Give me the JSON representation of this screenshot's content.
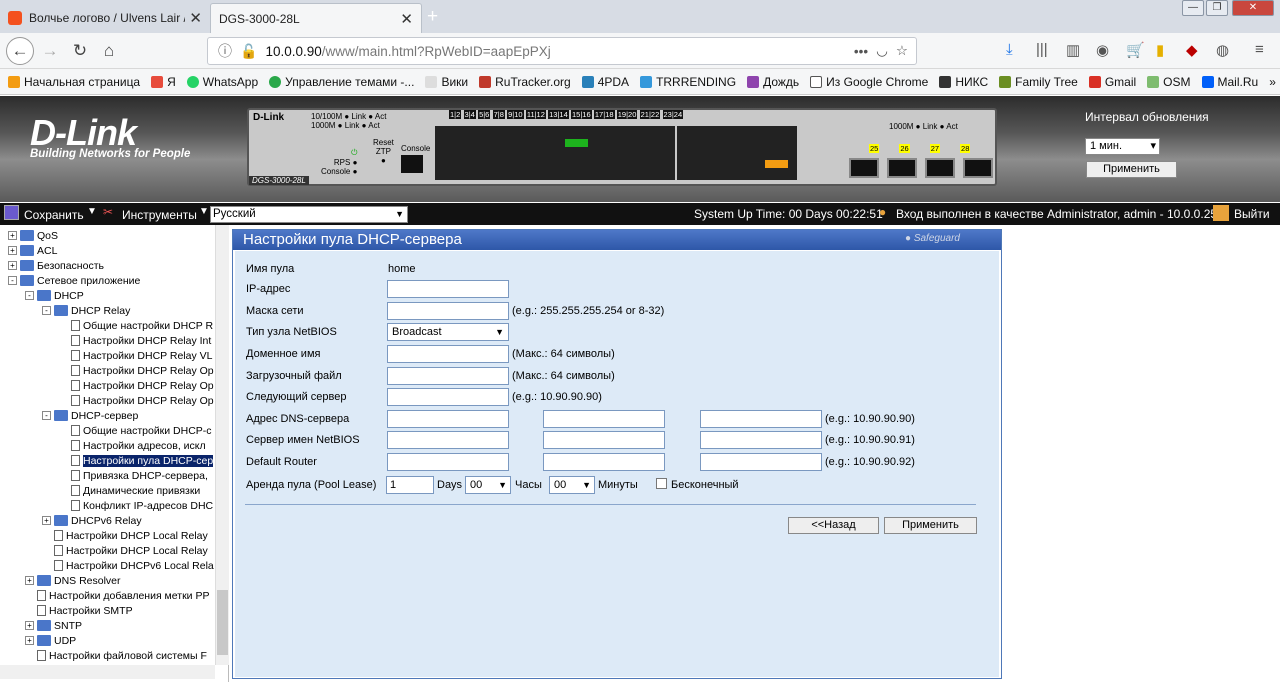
{
  "browser": {
    "tabs": [
      {
        "title": "Волчье логово / Ulvens Lair /"
      },
      {
        "title": "DGS-3000-28L"
      }
    ],
    "url_host": "10.0.0.90",
    "url_path": "/www/main.html?RpWebID=aapEpPXj",
    "bookmarks": [
      "Начальная страница",
      "Я",
      "WhatsApp",
      "Управление темами -...",
      "Вики",
      "RuTracker.org",
      "4PDA",
      "TRRRENDING",
      "Дождь",
      "Из Google Chrome",
      "НИКС",
      "Family Tree",
      "Gmail",
      "OSM",
      "Mail.Ru"
    ]
  },
  "banner": {
    "logo": "D-Link",
    "slogan": "Building Networks for People",
    "model": "DGS-3000-28L",
    "interval_label": "Интервал обновления",
    "interval_value": "1 мин.",
    "apply_label": "Применить"
  },
  "toolbar": {
    "save": "Сохранить",
    "tools": "Инструменты",
    "language": "Русский",
    "status": "System Up Time: 00 Days 00:22:51",
    "login": "Вход выполнен в качестве  Administrator, admin - 10.0.0.25",
    "logout": "Выйти"
  },
  "tree": [
    {
      "label": "QoS",
      "level": 0,
      "type": "folder",
      "exp": "+"
    },
    {
      "label": "ACL",
      "level": 0,
      "type": "folder",
      "exp": "+"
    },
    {
      "label": "Безопасность",
      "level": 0,
      "type": "folder",
      "exp": "+"
    },
    {
      "label": "Сетевое приложение",
      "level": 0,
      "type": "folder",
      "exp": "-"
    },
    {
      "label": "DHCP",
      "level": 1,
      "type": "folder",
      "exp": "-"
    },
    {
      "label": "DHCP Relay",
      "level": 2,
      "type": "folder",
      "exp": "-"
    },
    {
      "label": "Общие настройки DHCP R",
      "level": 3,
      "type": "doc"
    },
    {
      "label": "Настройки DHCP Relay Int",
      "level": 3,
      "type": "doc"
    },
    {
      "label": "Настройки DHCP Relay VL",
      "level": 3,
      "type": "doc"
    },
    {
      "label": "Настройки DHCP Relay Op",
      "level": 3,
      "type": "doc"
    },
    {
      "label": "Настройки DHCP Relay Op",
      "level": 3,
      "type": "doc"
    },
    {
      "label": "Настройки DHCP Relay Op",
      "level": 3,
      "type": "doc"
    },
    {
      "label": "DHCP-сервер",
      "level": 2,
      "type": "folder",
      "exp": "-"
    },
    {
      "label": "Общие настройки DHCP-с",
      "level": 3,
      "type": "doc"
    },
    {
      "label": "Настройки адресов, искл",
      "level": 3,
      "type": "doc"
    },
    {
      "label": "Настройки пула DHCP-сер",
      "level": 3,
      "type": "doc",
      "selected": true
    },
    {
      "label": "Привязка DHCP-сервера,",
      "level": 3,
      "type": "doc"
    },
    {
      "label": "Динамические привязки",
      "level": 3,
      "type": "doc"
    },
    {
      "label": "Конфликт IP-адресов DHC",
      "level": 3,
      "type": "doc"
    },
    {
      "label": "DHCPv6 Relay",
      "level": 2,
      "type": "folder",
      "exp": "+"
    },
    {
      "label": "Настройки DHCP Local Relay",
      "level": 2,
      "type": "doc"
    },
    {
      "label": "Настройки DHCP Local Relay",
      "level": 2,
      "type": "doc"
    },
    {
      "label": "Настройки DHCPv6 Local Rela",
      "level": 2,
      "type": "doc"
    },
    {
      "label": "DNS Resolver",
      "level": 1,
      "type": "folder",
      "exp": "+"
    },
    {
      "label": "Настройки добавления метки PP",
      "level": 1,
      "type": "doc"
    },
    {
      "label": "Настройки SMTP",
      "level": 1,
      "type": "doc"
    },
    {
      "label": "SNTP",
      "level": 1,
      "type": "folder",
      "exp": "+"
    },
    {
      "label": "UDP",
      "level": 1,
      "type": "folder",
      "exp": "+"
    },
    {
      "label": "Настройки файловой системы F",
      "level": 1,
      "type": "doc"
    }
  ],
  "form": {
    "title": "Настройки пула DHCP-сервера",
    "safeguard": "Safeguard",
    "pool_name_label": "Имя пула",
    "pool_name_value": "home",
    "ip_label": "IP-адрес",
    "mask_label": "Маска сети",
    "mask_hint": "(e.g.: 255.255.255.254 or 8-32)",
    "netbios_type_label": "Тип узла NetBIOS",
    "netbios_type_value": "Broadcast",
    "domain_label": "Доменное имя",
    "domain_hint": "(Макс.: 64 символы)",
    "boot_label": "Загрузочный файл",
    "boot_hint": "(Макс.: 64 символы)",
    "next_server_label": "Следующий сервер",
    "next_server_hint": "(e.g.: 10.90.90.90)",
    "dns_label": "Адрес DNS-сервера",
    "dns_hint": "(e.g.: 10.90.90.90)",
    "netbios_server_label": "Сервер имен NetBIOS",
    "netbios_server_hint": "(e.g.: 10.90.90.91)",
    "router_label": "Default Router",
    "router_hint": "(e.g.: 10.90.90.92)",
    "lease_label": "Аренда пула (Pool Lease)",
    "lease_days_value": "1",
    "days_label": "Days",
    "hours_value": "00",
    "hours_label": "Часы",
    "minutes_value": "00",
    "minutes_label": "Минуты",
    "infinite_label": "Бесконечный",
    "back_button": "<<Назад",
    "apply_button": "Применить"
  },
  "colors": {
    "title_bar": "#2e57a8",
    "content_bg": "#ddeaf7",
    "toolbar_bg": "#111111"
  }
}
